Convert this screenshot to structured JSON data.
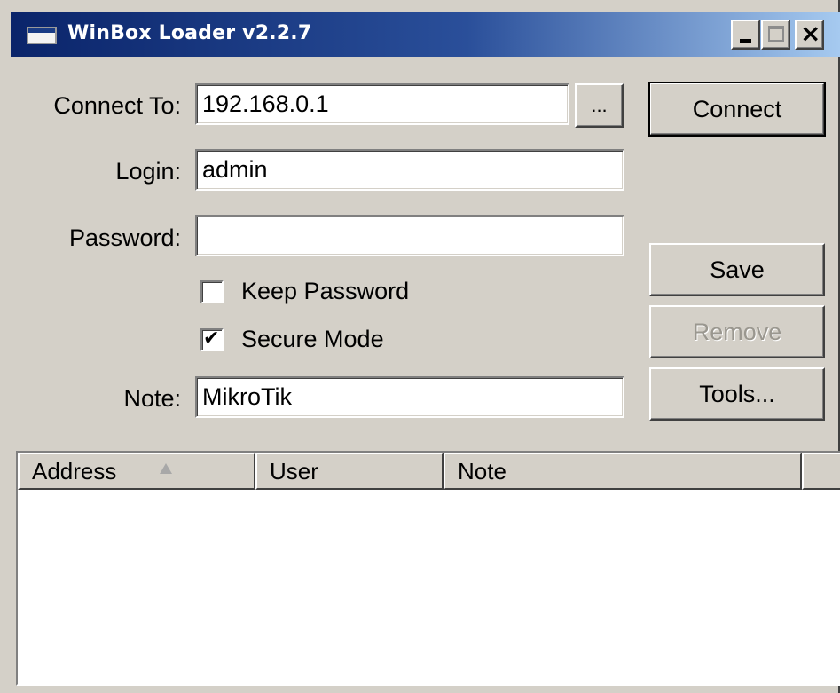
{
  "window": {
    "title": "WinBox Loader v2.2.7",
    "icons": {
      "app": "window-icon",
      "minimize": "minimize-icon",
      "maximize": "maximize-icon",
      "close": "close-icon",
      "sort": "sort-ascending-icon"
    }
  },
  "form": {
    "connect_to": {
      "label": "Connect To:",
      "value": "192.168.0.1",
      "browse_label": "..."
    },
    "login": {
      "label": "Login:",
      "value": "admin"
    },
    "password": {
      "label": "Password:",
      "value": ""
    },
    "keep_password": {
      "label": "Keep Password",
      "checked": false
    },
    "secure_mode": {
      "label": "Secure Mode",
      "checked": true,
      "check_glyph": "✔"
    },
    "note": {
      "label": "Note:",
      "value": "MikroTik"
    }
  },
  "buttons": {
    "connect": "Connect",
    "save": "Save",
    "remove": "Remove",
    "tools": "Tools..."
  },
  "list": {
    "columns": [
      "Address",
      "User",
      "Note"
    ],
    "rows": []
  },
  "colors": {
    "face": "#d4d0c8",
    "title_start": "#0a246a",
    "title_end": "#a6caf0"
  }
}
